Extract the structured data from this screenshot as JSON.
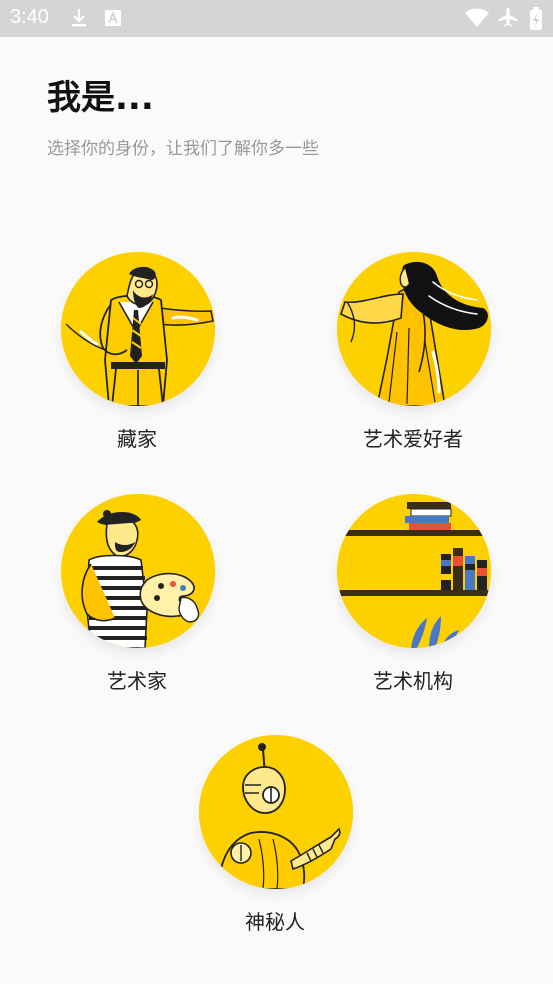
{
  "status_bar": {
    "time": "3:40",
    "icons": [
      "download-icon",
      "a-badge-icon",
      "wifi-icon",
      "airplane-icon",
      "battery-icon"
    ]
  },
  "header": {
    "title": "我是...",
    "subtitle": "选择你的身份，让我们了解你多一些"
  },
  "roles": [
    {
      "label": "藏家",
      "illustration": "collector-illustration"
    },
    {
      "label": "艺术爱好者",
      "illustration": "art-lover-illustration"
    },
    {
      "label": "艺术家",
      "illustration": "artist-illustration"
    },
    {
      "label": "艺术机构",
      "illustration": "art-institution-illustration"
    },
    {
      "label": "神秘人",
      "illustration": "mystery-person-illustration"
    }
  ],
  "colors": {
    "accent": "#fdd000",
    "background": "#fafafa",
    "status_bar": "#d5d5d5",
    "subtitle": "#999999"
  }
}
